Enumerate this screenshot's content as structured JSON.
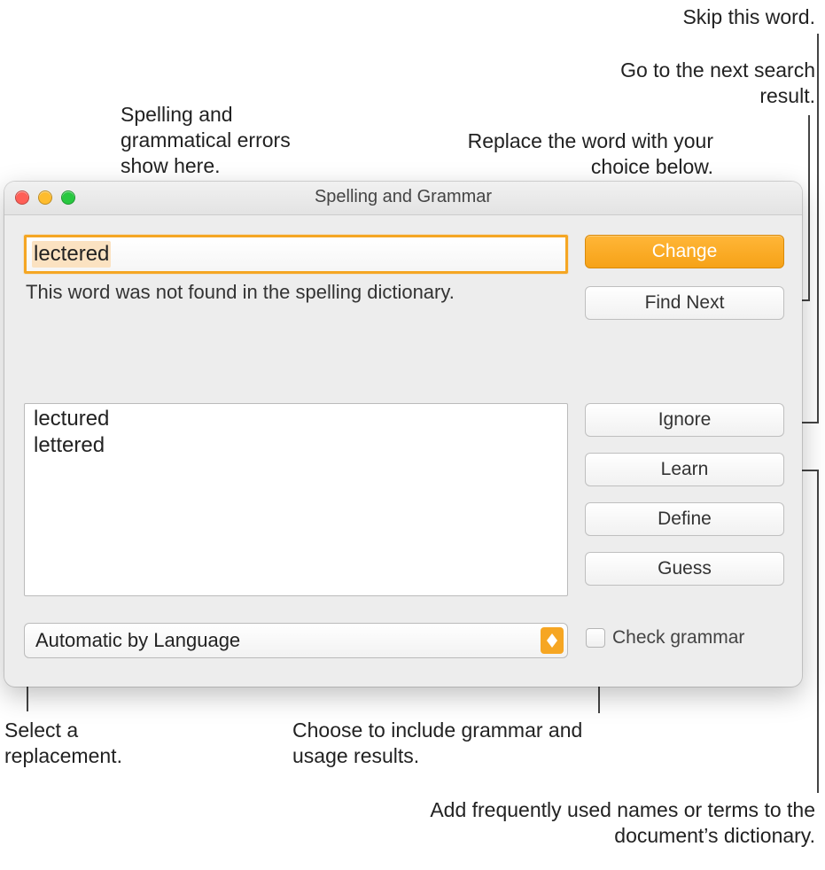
{
  "callouts": {
    "spellingErrors": "Spelling and grammatical errors show here.",
    "replaceWord": "Replace the word with your choice below.",
    "skipWord": "Skip this word.",
    "nextResult": "Go to the next search result.",
    "selectReplacement": "Select a replacement.",
    "includeGrammar": "Choose to include grammar and usage results.",
    "learnTerms": "Add frequently used names or terms to the document’s dictionary."
  },
  "window": {
    "title": "Spelling and Grammar"
  },
  "wordField": {
    "value": "lectered",
    "note": "This word was not found in the spelling dictionary."
  },
  "suggestions": {
    "items": [
      "lectured",
      "lettered"
    ]
  },
  "buttons": {
    "change": "Change",
    "findNext": "Find Next",
    "ignore": "Ignore",
    "learn": "Learn",
    "define": "Define",
    "guess": "Guess"
  },
  "languageSelect": {
    "value": "Automatic by Language"
  },
  "checkbox": {
    "label": "Check grammar"
  }
}
